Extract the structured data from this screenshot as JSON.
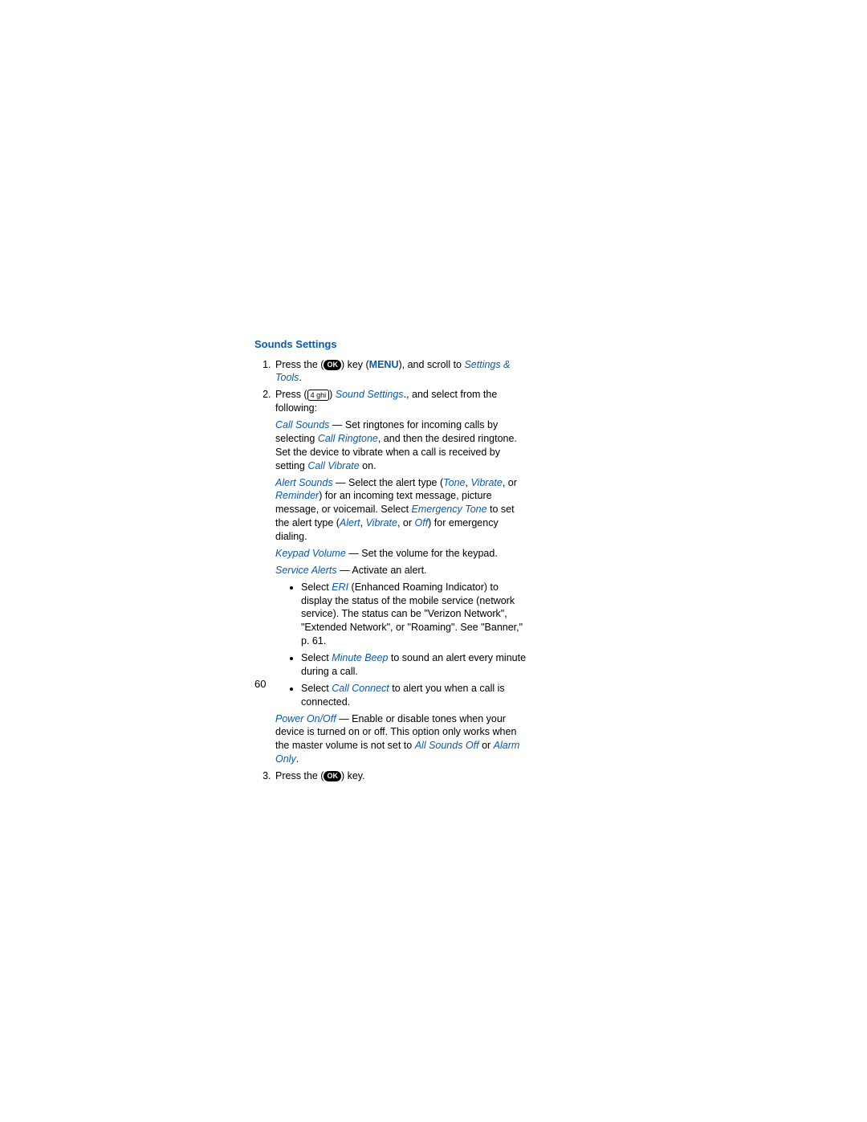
{
  "heading": "Sounds Settings",
  "step1": {
    "t1": "Press the (",
    "ok": "OK",
    "t2": ") key (",
    "menu": "MENU",
    "t3": "), and scroll to ",
    "link": "Settings & Tools",
    "t4": "."
  },
  "step2": {
    "t1": "Press (",
    "key": "4 ghi",
    "t2": ") ",
    "link": "Sound Settings",
    "t3": "., and select from the following:"
  },
  "callSounds": {
    "label": "Call Sounds",
    "t1": " — Set ringtones for incoming calls by selecting ",
    "ringtone": "Call Ringtone",
    "t2": ", and then the desired ringtone. Set the device to vibrate when a call is received by setting ",
    "vibrate": "Call Vibrate",
    "t3": " on."
  },
  "alertSounds": {
    "label": "Alert Sounds",
    "t1": " — Select the alert type (",
    "tone": "Tone",
    "c1": ", ",
    "vibrate": "Vibrate",
    "t2": ", or ",
    "reminder": "Reminder",
    "t3": ") for an incoming text message, picture message, or voicemail. Select ",
    "emergency": "Emergency Tone",
    "t4": " to set the alert type (",
    "alert": "Alert",
    "c2": ", ",
    "vib2": "Vibrate",
    "t5": ", or ",
    "off": "Off",
    "t6": ") for emergency dialing."
  },
  "keypad": {
    "label": "Keypad Volume",
    "t1": " — Set the volume for the keypad."
  },
  "service": {
    "label": "Service Alerts",
    "t1": " — Activate an alert."
  },
  "bullets": {
    "b1": {
      "t1": "Select ",
      "eri": "ERI",
      "t2": " (Enhanced Roaming Indicator) to display the status of the mobile service (network service). The status can be \"Verizon Network\", \"Extended Network\", or \"Roaming\". See \"Banner,\" p. 61."
    },
    "b2": {
      "t1": "Select ",
      "mb": "Minute Beep",
      "t2": " to sound an alert every minute during a call."
    },
    "b3": {
      "t1": "Select ",
      "cc": "Call Connect",
      "t2": " to alert you when a call is connected."
    }
  },
  "power": {
    "label": "Power On/Off",
    "t1": " — Enable or disable tones when your device is turned on or off. This option only works when the master volume is not set to ",
    "aso": "All Sounds Off",
    "t2": " or ",
    "ao": "Alarm Only",
    "t3": "."
  },
  "step3": {
    "t1": "Press the (",
    "ok": "OK",
    "t2": ") key."
  },
  "pageNum": "60"
}
